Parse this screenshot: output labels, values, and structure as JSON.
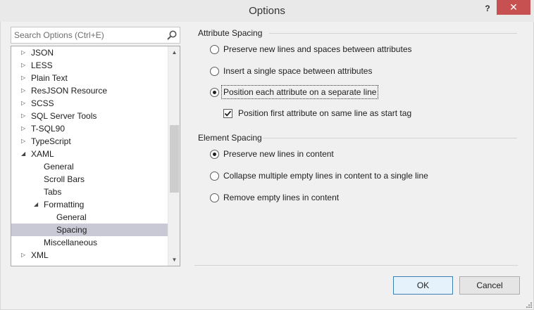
{
  "window": {
    "title": "Options",
    "help_glyph": "?",
    "close_glyph": "✕"
  },
  "search": {
    "placeholder": "Search Options (Ctrl+E)",
    "icon": "search-icon"
  },
  "tree": {
    "items": [
      {
        "label": "JSON",
        "level": 1,
        "arrow": "collapsed",
        "selected": false
      },
      {
        "label": "LESS",
        "level": 1,
        "arrow": "collapsed",
        "selected": false
      },
      {
        "label": "Plain Text",
        "level": 1,
        "arrow": "collapsed",
        "selected": false
      },
      {
        "label": "ResJSON Resource",
        "level": 1,
        "arrow": "collapsed",
        "selected": false
      },
      {
        "label": "SCSS",
        "level": 1,
        "arrow": "collapsed",
        "selected": false
      },
      {
        "label": "SQL Server Tools",
        "level": 1,
        "arrow": "collapsed",
        "selected": false
      },
      {
        "label": "T-SQL90",
        "level": 1,
        "arrow": "collapsed",
        "selected": false
      },
      {
        "label": "TypeScript",
        "level": 1,
        "arrow": "collapsed",
        "selected": false
      },
      {
        "label": "XAML",
        "level": 1,
        "arrow": "expanded",
        "selected": false
      },
      {
        "label": "General",
        "level": 2,
        "arrow": "none",
        "selected": false
      },
      {
        "label": "Scroll Bars",
        "level": 2,
        "arrow": "none",
        "selected": false
      },
      {
        "label": "Tabs",
        "level": 2,
        "arrow": "none",
        "selected": false
      },
      {
        "label": "Formatting",
        "level": 2,
        "arrow": "expanded",
        "selected": false
      },
      {
        "label": "General",
        "level": 3,
        "arrow": "none",
        "selected": false
      },
      {
        "label": "Spacing",
        "level": 3,
        "arrow": "none",
        "selected": true
      },
      {
        "label": "Miscellaneous",
        "level": 2,
        "arrow": "none",
        "selected": false
      },
      {
        "label": "XML",
        "level": 1,
        "arrow": "collapsed",
        "selected": false
      }
    ],
    "scroll_position": 0.62
  },
  "attribute_spacing": {
    "label": "Attribute Spacing",
    "options": [
      {
        "label": "Preserve new lines and spaces between attributes",
        "checked": false
      },
      {
        "label": "Insert a single space between attributes",
        "checked": false
      },
      {
        "label": "Position each attribute on a separate line",
        "checked": true
      }
    ],
    "sub_option": {
      "label": "Position first attribute on same line as start tag",
      "checked": true
    }
  },
  "element_spacing": {
    "label": "Element Spacing",
    "options": [
      {
        "label": "Preserve new lines in content",
        "checked": true
      },
      {
        "label": "Collapse multiple empty lines in content to a single line",
        "checked": false
      },
      {
        "label": "Remove empty lines in content",
        "checked": false
      }
    ]
  },
  "buttons": {
    "ok": "OK",
    "cancel": "Cancel"
  },
  "colors": {
    "close_button": "#c75050",
    "selection": "#c9c9d6",
    "default_button_border": "#3c7fb1"
  }
}
